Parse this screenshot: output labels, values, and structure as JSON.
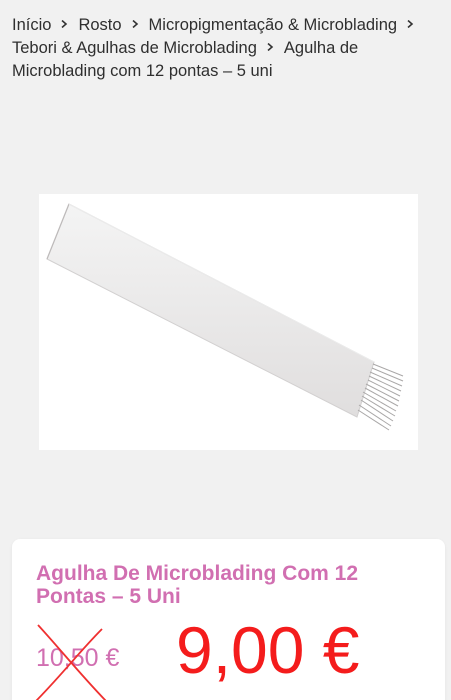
{
  "breadcrumb": {
    "items": [
      {
        "label": "Início"
      },
      {
        "label": "Rosto"
      },
      {
        "label": "Micropigmentação & Microblading"
      },
      {
        "label": "Tebori & Agulhas de Microblading"
      },
      {
        "label": "Agulha de Microblading com 12 pontas – 5 uni"
      }
    ]
  },
  "product": {
    "title": "Agulha De Microblading Com 12 Pontas – 5 Uni",
    "old_price": "10,50 €",
    "price": "9,00 €"
  },
  "colors": {
    "accent_pink": "#d16fb1",
    "price_red": "#f41c1c",
    "background": "#f1f1f1"
  },
  "icons": {
    "separator": "chevron-right-icon",
    "strike": "red-x-mark"
  }
}
